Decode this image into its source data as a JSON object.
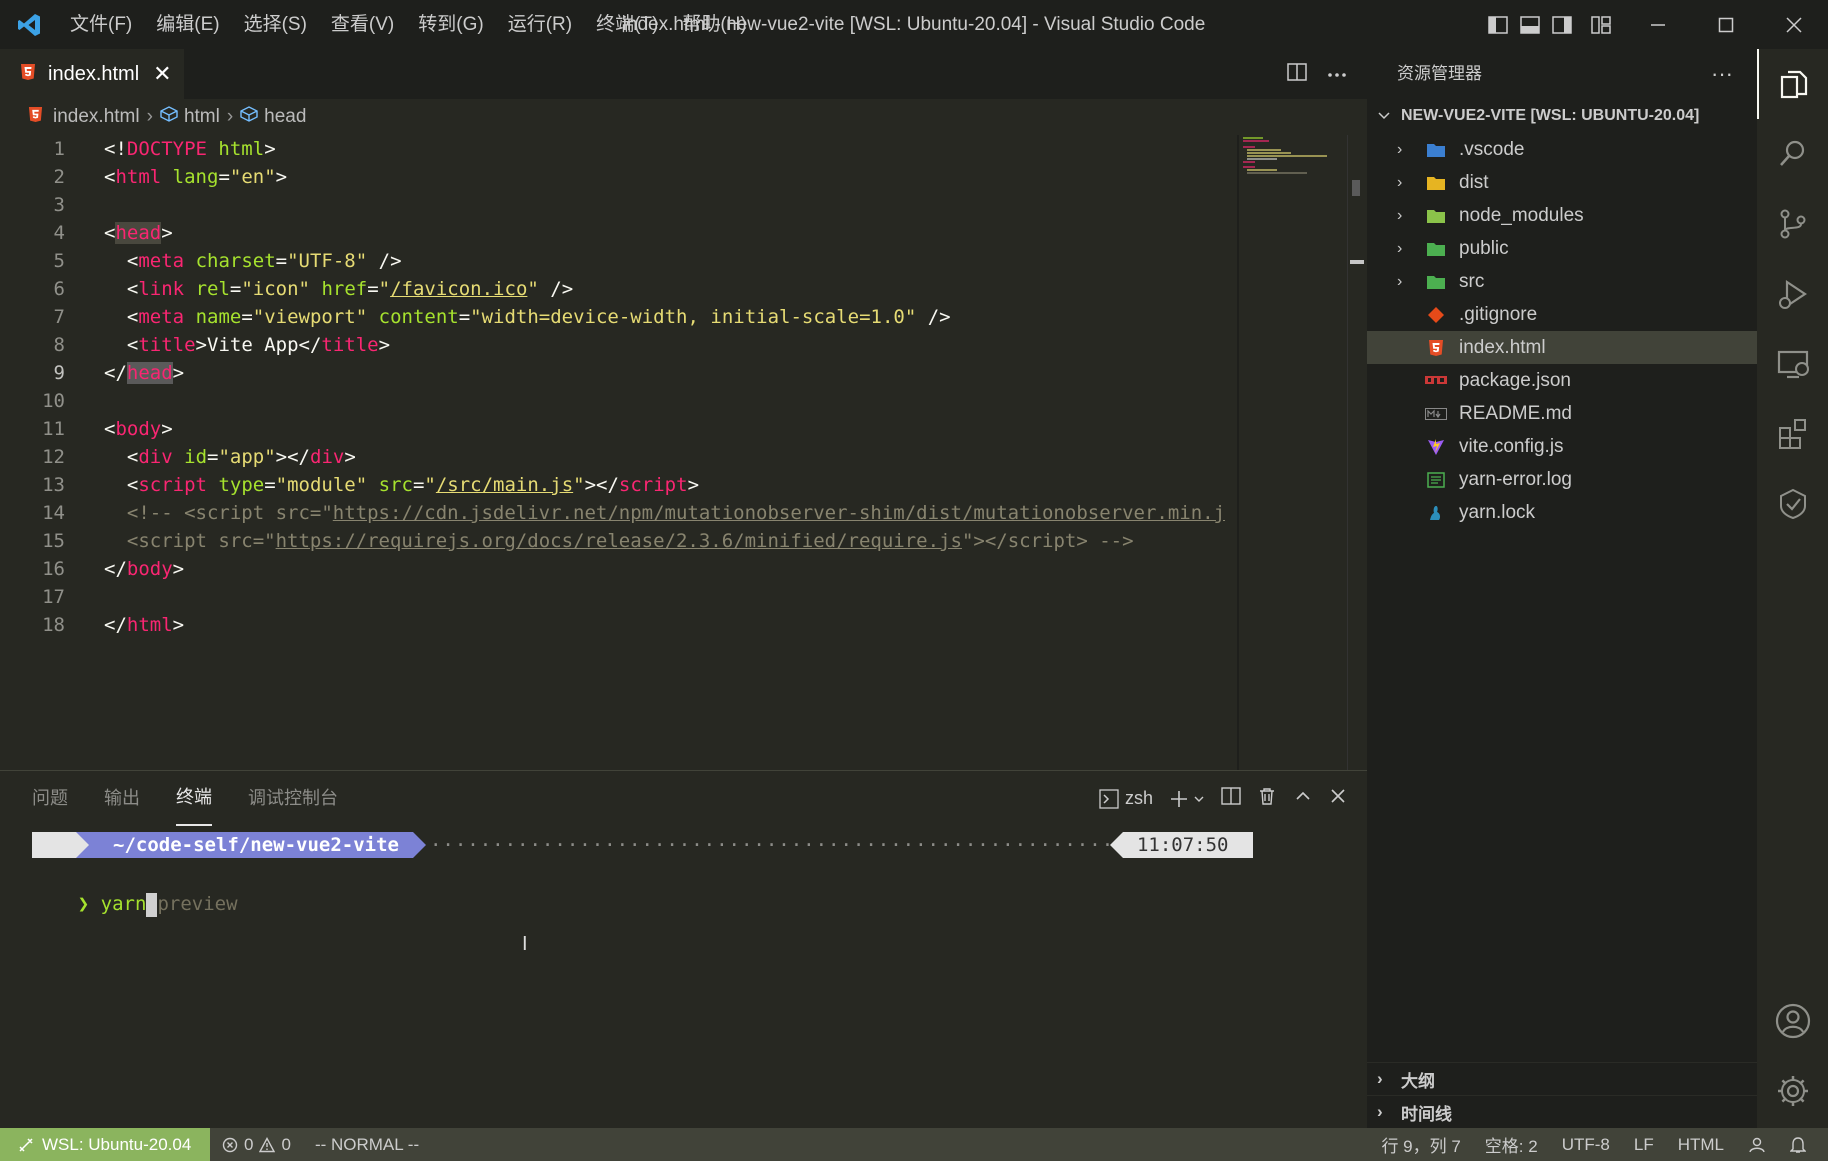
{
  "titlebar": {
    "menu": [
      "文件(F)",
      "编辑(E)",
      "选择(S)",
      "查看(V)",
      "转到(G)",
      "运行(R)",
      "终端(T)",
      "帮助(H)"
    ],
    "window_title": "index.html - new-vue2-vite [WSL: Ubuntu-20.04] - Visual Studio Code"
  },
  "editor_tab": {
    "label": "index.html",
    "close": "✕"
  },
  "breadcrumb": {
    "file": "index.html",
    "item1": "html",
    "item2": "head"
  },
  "editor": {
    "line_numbers": [
      "1",
      "2",
      "3",
      "4",
      "5",
      "6",
      "7",
      "8",
      "9",
      "10",
      "11",
      "12",
      "13",
      "14",
      "15",
      "16",
      "17",
      "18"
    ],
    "active_line": "9"
  },
  "panel": {
    "tabs": [
      "问题",
      "输出",
      "终端",
      "调试控制台"
    ],
    "active_tab": "终端",
    "shell_label": "zsh",
    "terminal": {
      "os_glyph": "",
      "folder_glyph": "",
      "cwd": "~/code-self/new-vue2-vite",
      "time": "11:07:50",
      "clock_glyph": "",
      "prompt_char": "❯",
      "command": "yarn",
      "suggestion": "preview"
    }
  },
  "explorer": {
    "header": "资源管理器",
    "root": "NEW-VUE2-VITE [WSL: UBUNTU-20.04]",
    "items": [
      {
        "name": ".vscode",
        "type": "folder",
        "icon_color": "#3b7fd1"
      },
      {
        "name": "dist",
        "type": "folder",
        "icon_color": "#e6b422"
      },
      {
        "name": "node_modules",
        "type": "folder",
        "icon_color": "#8bc34a"
      },
      {
        "name": "public",
        "type": "folder",
        "icon_color": "#4caf50"
      },
      {
        "name": "src",
        "type": "folder",
        "icon_color": "#4caf50"
      },
      {
        "name": ".gitignore",
        "type": "file",
        "icon_color": "#e64a19"
      },
      {
        "name": "index.html",
        "type": "file",
        "icon_color": "#e44d26"
      },
      {
        "name": "package.json",
        "type": "file",
        "icon_color": "#cb3837"
      },
      {
        "name": "README.md",
        "type": "file",
        "icon_color": "#666666"
      },
      {
        "name": "vite.config.js",
        "type": "file",
        "icon_color": "#9c5cf5"
      },
      {
        "name": "yarn-error.log",
        "type": "file",
        "icon_color": "#4caf50"
      },
      {
        "name": "yarn.lock",
        "type": "file",
        "icon_color": "#2c8ebb"
      }
    ],
    "selected": "index.html",
    "outline": "大纲",
    "timeline": "时间线"
  },
  "statusbar": {
    "remote": "WSL: Ubuntu-20.04",
    "errors": "0",
    "warnings": "0",
    "vim_mode": "-- NORMAL --",
    "position": "行 9，列 7",
    "indent": "空格: 2",
    "encoding": "UTF-8",
    "eol": "LF",
    "language": "HTML"
  },
  "colors": {
    "editor_bg": "#272822",
    "sidebar_bg": "#1e1f1c",
    "statusbar_bg": "#414339",
    "remote_bg": "#8bb45e",
    "tag": "#f92672",
    "attr": "#a6e22e",
    "string": "#e6db74",
    "comment": "#88846f"
  }
}
